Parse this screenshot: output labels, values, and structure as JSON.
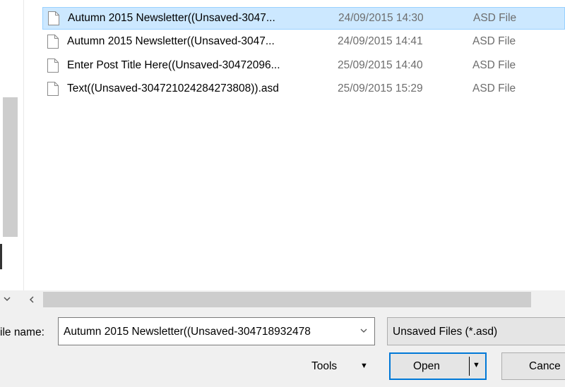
{
  "files": [
    {
      "name": "Autumn 2015 Newsletter((Unsaved-3047...",
      "date": "24/09/2015 14:30",
      "type": "ASD File",
      "selected": true
    },
    {
      "name": "Autumn 2015 Newsletter((Unsaved-3047...",
      "date": "24/09/2015 14:41",
      "type": "ASD File",
      "selected": false
    },
    {
      "name": "Enter Post Title Here((Unsaved-30472096...",
      "date": "25/09/2015 14:40",
      "type": "ASD File",
      "selected": false
    },
    {
      "name": "Text((Unsaved-304721024284273808)).asd",
      "date": "25/09/2015 15:29",
      "type": "ASD File",
      "selected": false
    }
  ],
  "icons": {
    "collapse": "chevron-down-icon",
    "scroll_left": "chevron-left-icon",
    "file": "document-icon"
  },
  "footer": {
    "filename_label": "ile name:",
    "filename_value": "Autumn 2015 Newsletter((Unsaved-304718932478",
    "filetype_value": "Unsaved Files (*.asd)",
    "tools_label": "Tools",
    "open_label": "Open",
    "cancel_label": "Cance"
  },
  "colors": {
    "selection_bg": "#cce8ff",
    "selection_border": "#99d1ff",
    "primary_button_border": "#0078d7"
  }
}
